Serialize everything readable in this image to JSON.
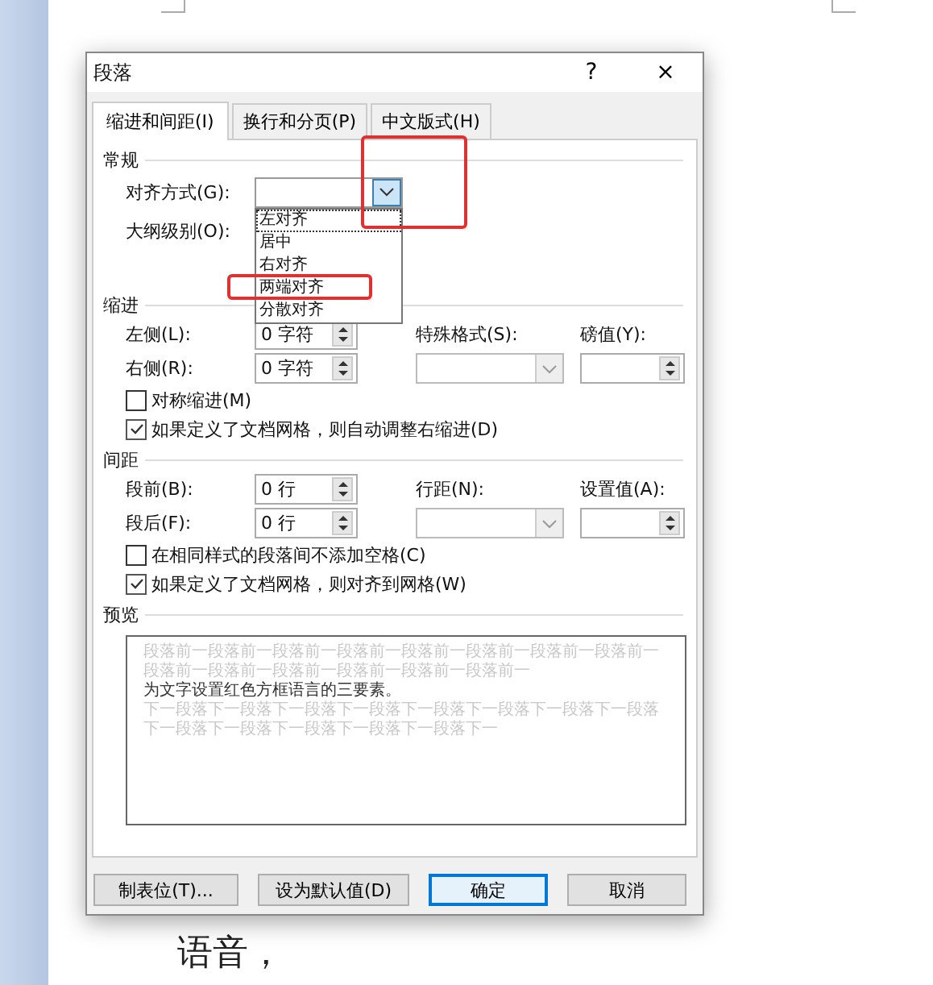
{
  "document": {
    "text": "语音，"
  },
  "dialog": {
    "title": "段落",
    "help": "?",
    "close": "×",
    "tabs": [
      {
        "label": "缩进和间距(I)",
        "selected": true
      },
      {
        "label": "换行和分页(P)",
        "selected": false
      },
      {
        "label": "中文版式(H)",
        "selected": false
      }
    ],
    "general": {
      "heading": "常规",
      "alignment_label": "对齐方式(G):",
      "outline_label": "大纲级别(O):",
      "alignment_options": [
        {
          "label": "左对齐",
          "selected": true
        },
        {
          "label": "居中",
          "selected": false
        },
        {
          "label": "右对齐",
          "selected": false
        },
        {
          "label": "两端对齐",
          "selected": false
        },
        {
          "label": "分散对齐",
          "selected": false
        }
      ]
    },
    "indent": {
      "heading": "缩进",
      "left_label": "左侧(L):",
      "left_value": "0 字符",
      "right_label": "右侧(R):",
      "right_value": "0 字符",
      "special_label": "特殊格式(S):",
      "by_label": "磅值(Y):",
      "checks": [
        {
          "label": "对称缩进(M)",
          "checked": false
        },
        {
          "label": "如果定义了文档网格，则自动调整右缩进(D)",
          "checked": true
        }
      ]
    },
    "spacing": {
      "heading": "间距",
      "before_label": "段前(B):",
      "before_value": "0 行",
      "after_label": "段后(F):",
      "after_value": "0 行",
      "line_label": "行距(N):",
      "at_label": "设置值(A):",
      "checks": [
        {
          "label": "在相同样式的段落间不添加空格(C)",
          "checked": false
        },
        {
          "label": "如果定义了文档网格，则对齐到网格(W)",
          "checked": true
        }
      ]
    },
    "preview": {
      "heading": "预览",
      "previous": "段落前一段落前一段落前一段落前一段落前一段落前一段落前一段落前一段落前一段落前一段落前一段落前一段落前一段落前一",
      "current": "为文字设置红色方框语言的三要素。",
      "next": "下一段落下一段落下一段落下一段落下一段落下一段落下一段落下一段落下一段落下一段落下一段落下一段落下一段落下一"
    },
    "buttons": [
      {
        "label": "制表位(T)...",
        "kind": "plain"
      },
      {
        "label": "设为默认值(D)",
        "kind": "plain"
      },
      {
        "label": "确定",
        "kind": "default"
      },
      {
        "label": "取消",
        "kind": "plain"
      }
    ]
  },
  "annotations": [
    {
      "kind": "box"
    },
    {
      "kind": "box"
    }
  ]
}
